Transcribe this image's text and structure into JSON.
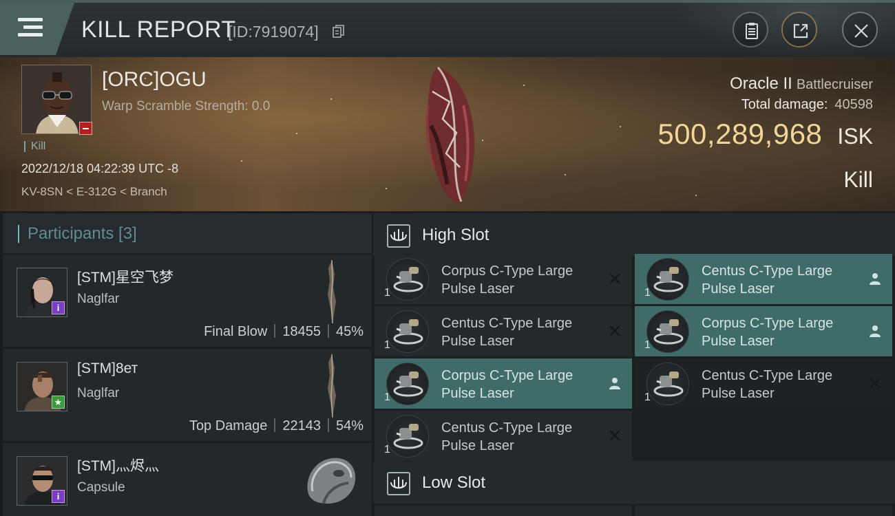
{
  "header": {
    "title": "KILL REPORT",
    "kill_id": "[ID:7919074]"
  },
  "victim": {
    "name": "[ORC]OGU",
    "warp_scramble": "Warp Scramble Strength: 0.0",
    "kill_tag": "Kill",
    "datetime": "2022/12/18 04:22:39 UTC -8",
    "location": "KV-8SN < E-312G < Branch",
    "ship_name": "Oracle II",
    "ship_class": "Battlecruiser",
    "total_damage_label": "Total damage:",
    "total_damage": "40598",
    "isk_value": "500,289,968",
    "isk_unit": "ISK",
    "result": "Kill"
  },
  "participants": {
    "header": "Participants [3]",
    "rows": [
      {
        "name": "[STM]星空飞梦",
        "ship": "Naglfar",
        "role": "Final Blow",
        "damage": "18455",
        "percent": "45%",
        "badge": "i"
      },
      {
        "name": "[STM]8ет",
        "ship": "Naglfar",
        "role": "Top Damage",
        "damage": "22143",
        "percent": "54%",
        "badge": "★"
      },
      {
        "name": "[STM]灬烬灬",
        "ship": "Capsule",
        "badge": "i"
      }
    ]
  },
  "fitting": {
    "high_slot_label": "High Slot",
    "low_slot_label": "Low Slot",
    "high_slot": [
      {
        "name": "Corpus C-Type Large Pulse Laser",
        "qty": "1",
        "status": "destroyed"
      },
      {
        "name": "Centus C-Type Large Pulse Laser",
        "qty": "1",
        "status": "dropped"
      },
      {
        "name": "Centus C-Type Large Pulse Laser",
        "qty": "1",
        "status": "destroyed"
      },
      {
        "name": "Corpus C-Type Large Pulse Laser",
        "qty": "1",
        "status": "dropped"
      },
      {
        "name": "Corpus C-Type Large Pulse Laser",
        "qty": "1",
        "status": "dropped"
      },
      {
        "name": "Centus C-Type Large Pulse Laser",
        "qty": "1",
        "status": "destroyed"
      },
      {
        "name": "Centus C-Type Large Pulse Laser",
        "qty": "1",
        "status": "destroyed"
      }
    ]
  },
  "colors": {
    "accent_teal": "#3f6b69",
    "isk_gold": "#f2d59a",
    "badge_red": "#b32020",
    "badge_purple": "#7a3ec4",
    "badge_green": "#3b9a3f"
  }
}
